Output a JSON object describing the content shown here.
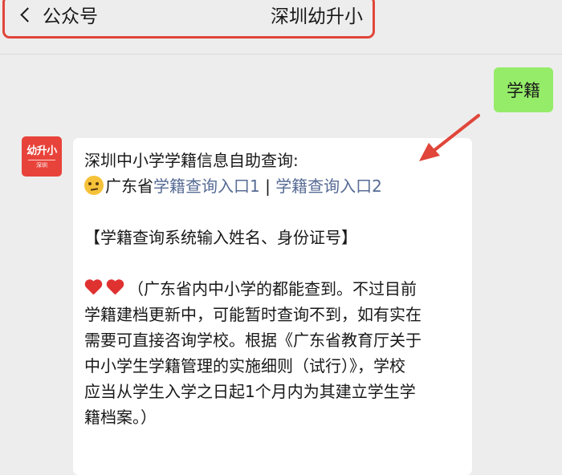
{
  "header": {
    "back_label": "公众号",
    "account_name": "深圳幼升小"
  },
  "avatar": {
    "main": "幼升小",
    "sub": "深圳"
  },
  "messages": {
    "outgoing": "学籍",
    "incoming": {
      "line1": "深圳中小学学籍信息自助查询:",
      "line2_prefix": "广东省",
      "link1": "学籍查询入口1",
      "separator": " | ",
      "link2": "学籍查询入口2",
      "line3": "【学籍查询系统输入姓名、身份证号】",
      "line4": "（广东省内中小学的都能查到。不过目前",
      "line5": "学籍建档更新中，可能暂时查询不到，如有实在",
      "line6": "需要可直接咨询学校。根据《广东省教育厅关于",
      "line7": "中小学生学籍管理的实施细则（试行）》，学校",
      "line8": "应当从学生入学之日起1个月内为其建立学生学",
      "line9": "籍档案。）"
    }
  },
  "colors": {
    "highlight": "#e0463a",
    "link": "#576b95",
    "outgoing_bubble": "#95ec69",
    "avatar_bg": "#e8433a"
  }
}
